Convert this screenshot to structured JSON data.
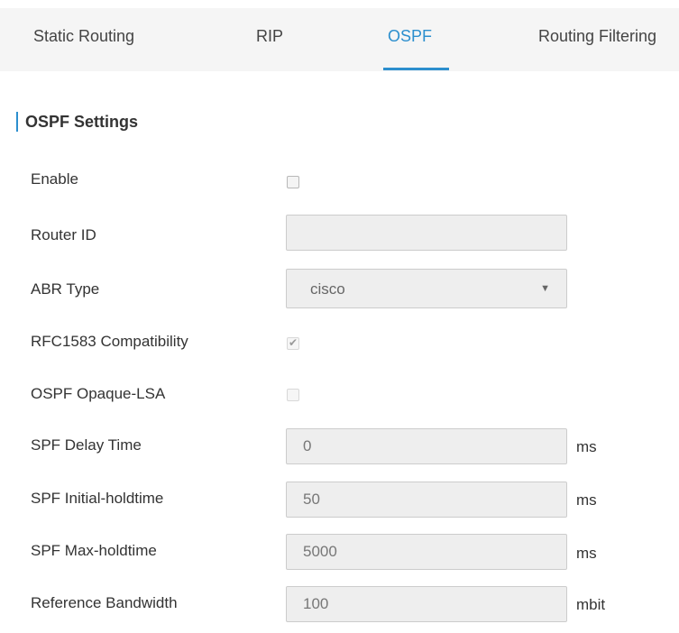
{
  "tabs": {
    "static_routing": "Static Routing",
    "rip": "RIP",
    "ospf": "OSPF",
    "routing_filtering": "Routing Filtering",
    "active": "OSPF"
  },
  "section": {
    "title": "OSPF Settings"
  },
  "fields": {
    "enable": {
      "label": "Enable",
      "checked": false
    },
    "router_id": {
      "label": "Router ID",
      "value": ""
    },
    "abr_type": {
      "label": "ABR Type",
      "value": "cisco"
    },
    "rfc1583": {
      "label": "RFC1583 Compatibility",
      "checked": true
    },
    "opaque_lsa": {
      "label": "OSPF Opaque-LSA",
      "checked": false
    },
    "spf_delay": {
      "label": "SPF Delay Time",
      "value": "0",
      "unit": "ms"
    },
    "spf_initial": {
      "label": "SPF Initial-holdtime",
      "value": "50",
      "unit": "ms"
    },
    "spf_max": {
      "label": "SPF Max-holdtime",
      "value": "5000",
      "unit": "ms"
    },
    "ref_bandwidth": {
      "label": "Reference Bandwidth",
      "value": "100",
      "unit": "mbit"
    }
  },
  "colors": {
    "accent": "#2c8fce",
    "tabbar_bg": "#f5f5f5",
    "input_bg": "#eeeeee"
  },
  "icons": {
    "dropdown": "caret-down-icon",
    "check": "checkmark-icon"
  }
}
